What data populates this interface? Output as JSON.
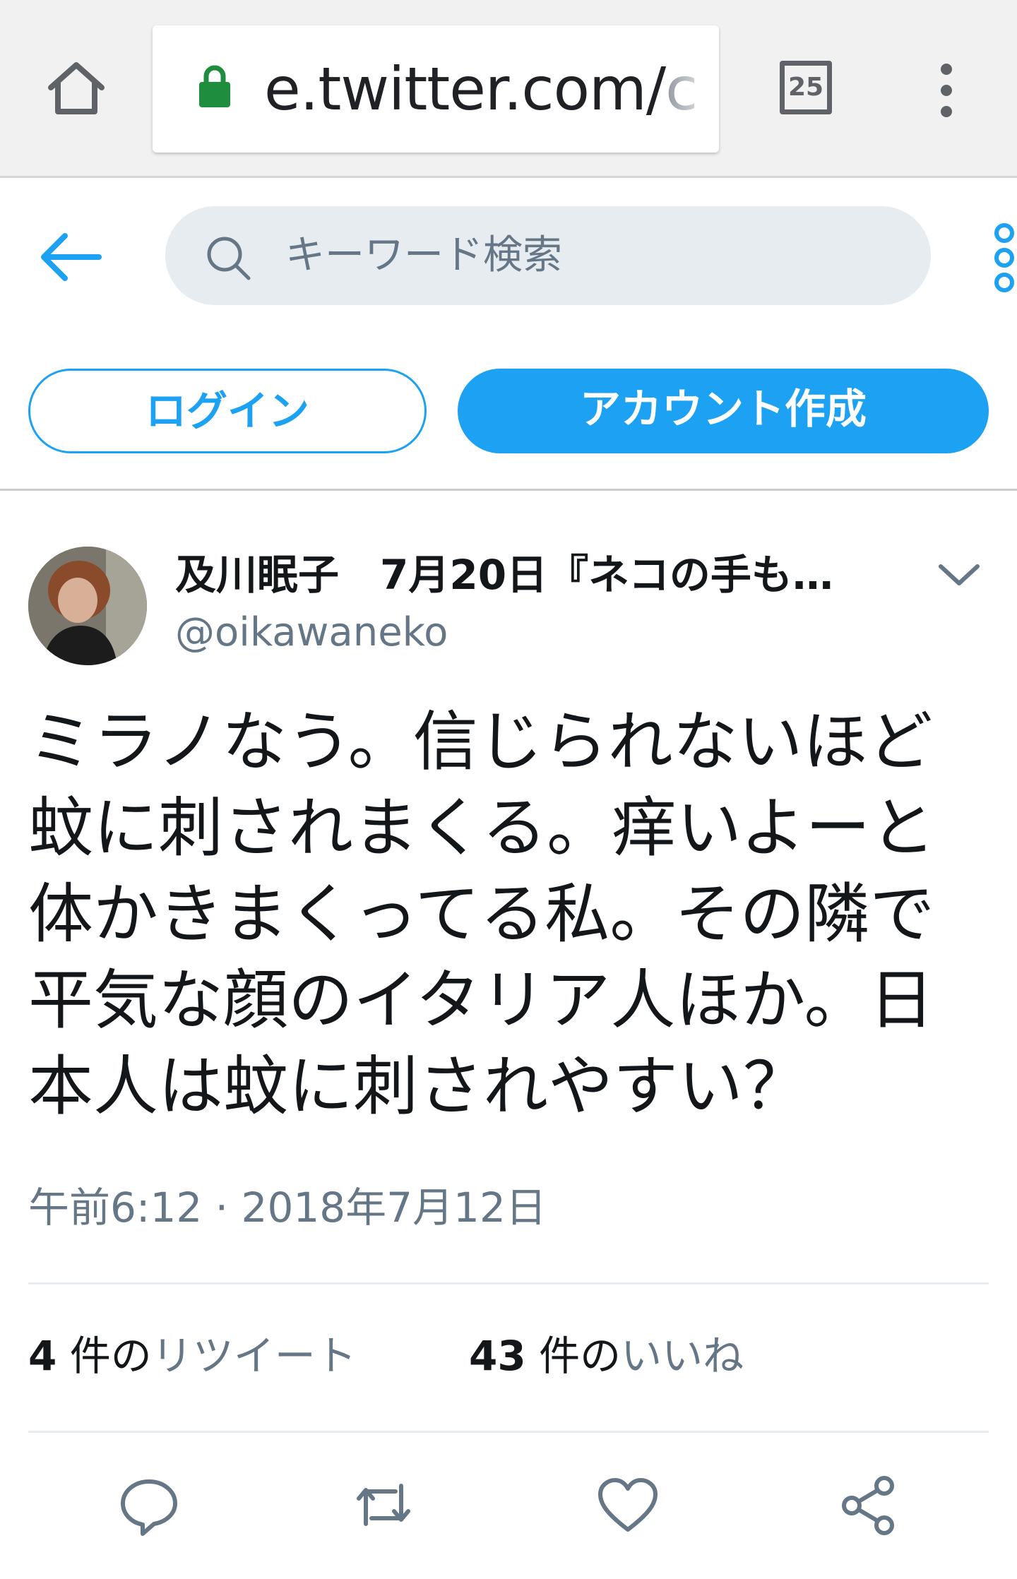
{
  "browser": {
    "url_visible": "e.twitter.com/",
    "url_tail": "c",
    "tab_count": "25",
    "icons": {
      "home": "home-icon",
      "lock": "lock-icon",
      "menu": "more-vert-icon"
    }
  },
  "header": {
    "search_placeholder": "キーワード検索",
    "icons": {
      "back": "arrow-left-icon",
      "search": "search-icon",
      "more": "more-vert-icon"
    }
  },
  "auth": {
    "login_label": "ログイン",
    "signup_label": "アカウント作成"
  },
  "tweet": {
    "author_name": "及川眠子　7月20日『ネコの手も…",
    "author_handle": "@oikawaneko",
    "text": "ミラノなう。信じられないほど蚊に刺されまくる。痒いよーと体かきまくってる私。その隣で平気な顔のイタリア人ほか。日本人は蚊に刺されやすい？",
    "timestamp": "午前6:12 · 2018年7月12日",
    "retweets": {
      "count": "4",
      "unit": " 件の",
      "label": "リツイート"
    },
    "likes": {
      "count": "43",
      "unit": " 件の",
      "label": "いいね"
    },
    "actions": [
      "reply-icon",
      "retweet-icon",
      "like-icon",
      "share-icon"
    ]
  },
  "colors": {
    "accent": "#1da1f2",
    "text": "#14171a",
    "secondary": "#657786",
    "search_bg": "#e6ecf0",
    "lock_green": "#1e8e3e"
  }
}
